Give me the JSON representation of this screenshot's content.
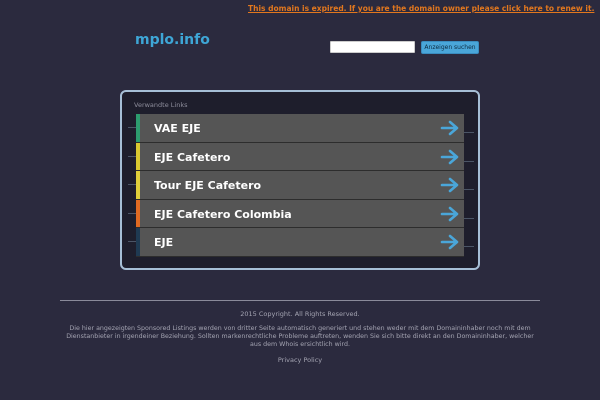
{
  "header": {
    "expired_notice": "This domain is expired. If you are the domain owner please click here to renew it.",
    "logo": "mplo.info",
    "search_placeholder": "",
    "search_button": "Anzeigen suchen"
  },
  "related": {
    "heading": "Verwandte Links",
    "icon": "arrow-right-icon",
    "items": [
      {
        "label": "VAE EJE",
        "stripe": "#2d9c6e"
      },
      {
        "label": "EJE Cafetero",
        "stripe": "#d9c830"
      },
      {
        "label": "Tour EJE Cafetero",
        "stripe": "#e0cf3a"
      },
      {
        "label": "EJE Cafetero Colombia",
        "stripe": "#e06a22"
      },
      {
        "label": "EJE",
        "stripe": "#1f3a52"
      }
    ]
  },
  "footer": {
    "copyright": "2015 Copyright. All Rights Reserved.",
    "disclaimer": "Die hier angezeigten Sponsored Listings werden von dritter Seite automatisch generiert und stehen weder mit dem Domaininhaber noch mit dem Dienstanbieter in irgendeiner Beziehung. Sollten markenrechtliche Probleme auftreten, wenden Sie sich bitte direkt an den Domaininhaber, welcher aus dem Whois ersichtlich wird.",
    "privacy": "Privacy Policy"
  },
  "colors": {
    "background": "#2b2a3e",
    "accent": "#3ea6d6",
    "warning": "#e2771e"
  }
}
